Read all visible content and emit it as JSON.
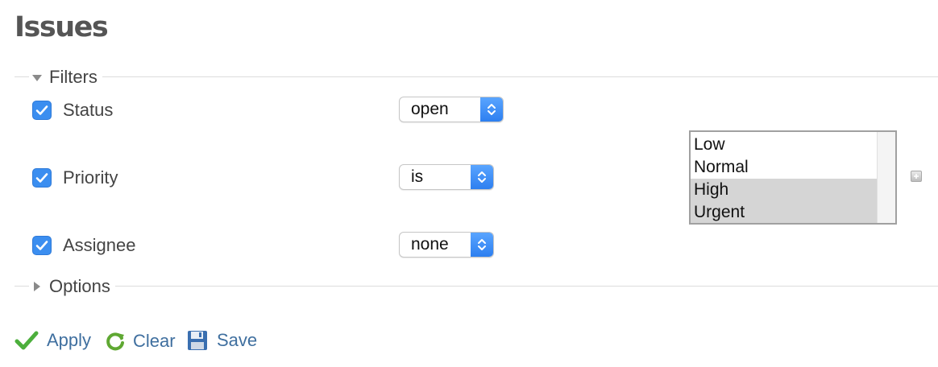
{
  "page": {
    "title": "Issues"
  },
  "filters": {
    "legend": "Filters",
    "rows": [
      {
        "label": "Status",
        "checked": true,
        "operator": "open"
      },
      {
        "label": "Priority",
        "checked": true,
        "operator": "is"
      },
      {
        "label": "Assignee",
        "checked": true,
        "operator": "none"
      }
    ],
    "priority_values": {
      "options": [
        "Low",
        "Normal",
        "High",
        "Urgent"
      ],
      "selected": [
        "High",
        "Urgent"
      ]
    },
    "add_icon": "plus-icon"
  },
  "options": {
    "legend": "Options"
  },
  "actions": {
    "apply": {
      "label": "Apply",
      "icon": "checkmark-icon",
      "color": "#4caf3c"
    },
    "clear": {
      "label": "Clear",
      "icon": "reload-icon",
      "color": "#5fa832"
    },
    "save": {
      "label": "Save",
      "icon": "floppy-disk-icon",
      "color": "#3a6fb0"
    }
  },
  "colors": {
    "link": "#3f6f9f",
    "accent": "#3b8ef0",
    "title": "#555555"
  }
}
